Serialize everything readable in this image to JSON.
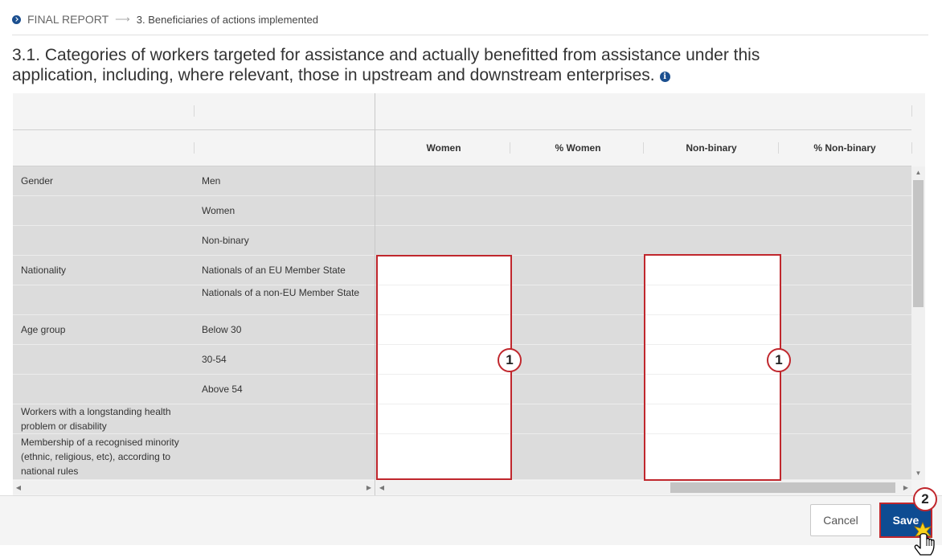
{
  "breadcrumb": {
    "root": "FINAL REPORT",
    "current": "3. Beneficiaries of actions implemented"
  },
  "section": {
    "title": "3.1. Categories of workers targeted for assistance and actually benefitted from assistance under this application, including, where relevant, those in upstream and downstream enterprises."
  },
  "table": {
    "columns": [
      "Women",
      "% Women",
      "Non-binary",
      "% Non-binary"
    ],
    "rows": [
      {
        "category": "Gender",
        "sub": "Men"
      },
      {
        "category": "",
        "sub": "Women"
      },
      {
        "category": "",
        "sub": "Non-binary"
      },
      {
        "category": "Nationality",
        "sub": "Nationals of an EU Member State"
      },
      {
        "category": "",
        "sub": "Nationals of a non-EU Member State"
      },
      {
        "category": "Age group",
        "sub": "Below 30"
      },
      {
        "category": "",
        "sub": "30-54"
      },
      {
        "category": "",
        "sub": "Above 54"
      },
      {
        "category": "Workers with a longstanding health problem or disability",
        "sub": ""
      },
      {
        "category": "Membership of a recognised minority (ethnic, religious, etc), according to national rules",
        "sub": ""
      }
    ]
  },
  "callouts": {
    "women_column": "1",
    "nonbinary_column": "1",
    "save": "2"
  },
  "buttons": {
    "cancel": "Cancel",
    "save": "Save"
  },
  "colors": {
    "accent": "#0e4c92",
    "highlight": "#c0272d"
  },
  "icons": {
    "breadcrumb": "chevron-circle-right-icon",
    "info": "info-circle-icon",
    "cursor": "hand-pointer-icon"
  }
}
